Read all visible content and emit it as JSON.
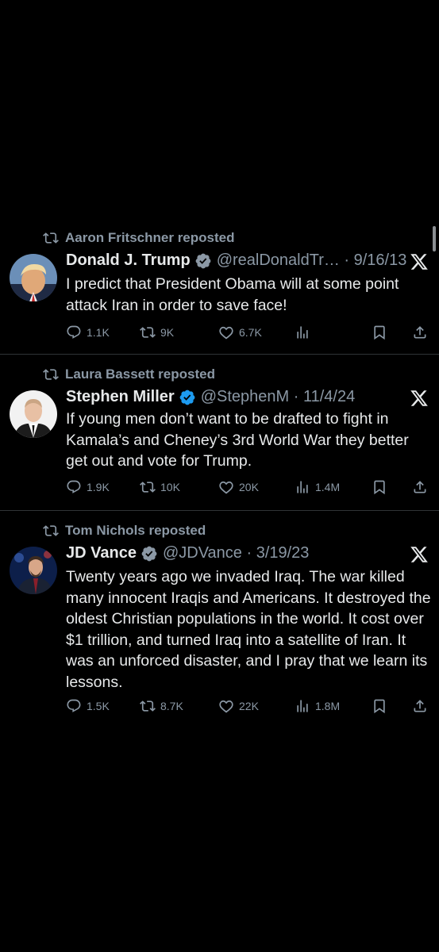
{
  "colors": {
    "background": "#000000",
    "primary_text": "#e7e9ea",
    "secondary_text": "#8b98a5",
    "verified_blue": "#1d9bf0",
    "divider": "#2f3336"
  },
  "tweets": [
    {
      "reposted_by": "Aaron Fritschner reposted",
      "name": "Donald J. Trump",
      "handle": "@realDonaldTr… · 9/16/13",
      "text": "I predict that President Obama will at some point attack Iran in order to save face!",
      "replies": "1.1K",
      "reposts": "9K",
      "likes": "6.7K",
      "views": ""
    },
    {
      "reposted_by": "Laura Bassett reposted",
      "name": "Stephen Miller",
      "handle": "@StephenM · 11/4/24",
      "text": "If young men don’t want to be drafted to fight in Kamala’s and Cheney’s 3rd World War they better get out and vote for Trump.",
      "replies": "1.9K",
      "reposts": "10K",
      "likes": "20K",
      "views": "1.4M"
    },
    {
      "reposted_by": "Tom Nichols reposted",
      "name": "JD Vance",
      "handle": "@JDVance · 3/19/23",
      "text": "Twenty years ago we invaded Iraq. The war killed many innocent Iraqis and Americans. It destroyed the oldest Christian populations in the world. It cost over $1 trillion, and turned Iraq into a satellite of Iran. It was an unforced disaster, and I pray that we learn its lessons.",
      "replies": "1.5K",
      "reposts": "8.7K",
      "likes": "22K",
      "views": "1.8M"
    }
  ]
}
